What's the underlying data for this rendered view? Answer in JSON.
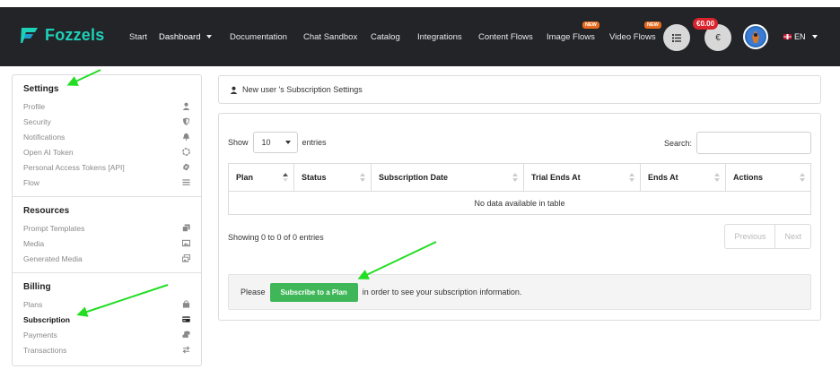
{
  "brand": {
    "name": "Fozzels",
    "color": "#1fd0b8"
  },
  "nav": {
    "items": [
      {
        "label": "Start"
      },
      {
        "label": "Dashboard"
      },
      {
        "label": "Documentation"
      },
      {
        "label": "Chat Sandbox"
      },
      {
        "label": "Catalog"
      },
      {
        "label": "Integrations"
      },
      {
        "label": "Content Flows"
      },
      {
        "label": "Image Flows",
        "badge": "NEW"
      },
      {
        "label": "Video Flows",
        "badge": "NEW"
      }
    ],
    "credit": "€0.00",
    "currency_symbol": "€",
    "language": "EN"
  },
  "sidebar": {
    "sections": [
      {
        "heading": "Settings",
        "items": [
          {
            "label": "Profile",
            "icon": "user-icon"
          },
          {
            "label": "Security",
            "icon": "shield-icon"
          },
          {
            "label": "Notifications",
            "icon": "bell-icon"
          },
          {
            "label": "Open AI Token",
            "icon": "openai-icon"
          },
          {
            "label": "Personal Access Tokens [API]",
            "icon": "api-icon"
          },
          {
            "label": "Flow",
            "icon": "lines-icon"
          }
        ]
      },
      {
        "heading": "Resources",
        "items": [
          {
            "label": "Prompt Templates",
            "icon": "copy-icon"
          },
          {
            "label": "Media",
            "icon": "image-icon"
          },
          {
            "label": "Generated Media",
            "icon": "images-icon"
          }
        ]
      },
      {
        "heading": "Billing",
        "items": [
          {
            "label": "Plans",
            "icon": "bag-icon"
          },
          {
            "label": "Subscription",
            "icon": "card-icon",
            "active": true
          },
          {
            "label": "Payments",
            "icon": "coins-icon"
          },
          {
            "label": "Transactions",
            "icon": "exchange-icon"
          }
        ]
      }
    ]
  },
  "main": {
    "title": "New user 's Subscription Settings",
    "show_label": "Show",
    "length_value": "10",
    "entries_label": "entries",
    "search_label": "Search:",
    "columns": [
      "Plan",
      "Status",
      "Subscription Date",
      "Trial Ends At",
      "Ends At",
      "Actions"
    ],
    "empty_text": "No data available in table",
    "info_text": "Showing 0 to 0 of 0 entries",
    "pager": {
      "previous": "Previous",
      "next": "Next"
    },
    "notice": {
      "before": "Please",
      "button": "Subscribe to a Plan",
      "after": "in order to see your subscription information."
    }
  },
  "colors": {
    "navbar": "#222428",
    "accent_green": "#3fb758",
    "badge_orange": "#e86a1e",
    "credit_red": "#d9232d",
    "arrow_green": "#22dd22"
  }
}
